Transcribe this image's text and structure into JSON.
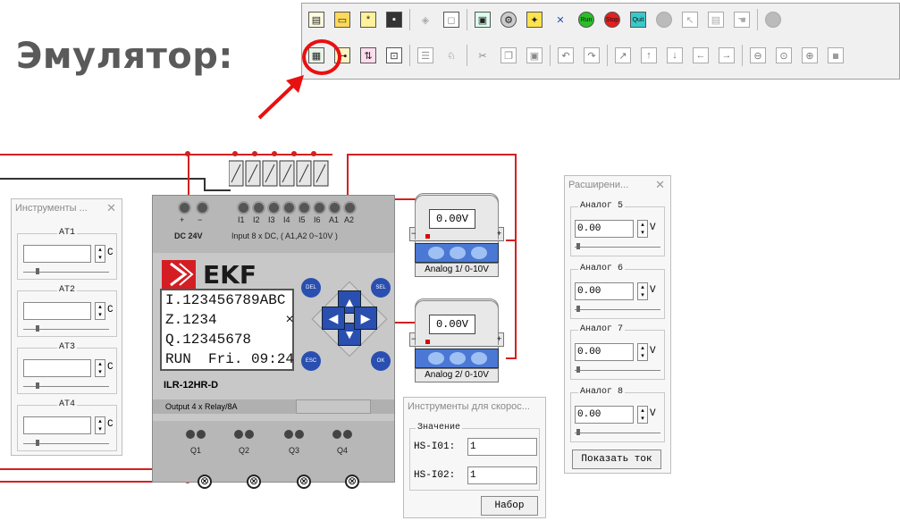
{
  "heading": "Эмулятор:",
  "toolbar": {
    "row1": [
      "new-icon",
      "open-icon",
      "plus-icon",
      "save-icon",
      "cube-icon",
      "preview-icon",
      "monitor-icon",
      "gear-icon",
      "chip-icon",
      "tools-icon",
      "run-icon",
      "stop-icon",
      "quit-icon",
      "disk-icon",
      "cursor-icon",
      "doc-icon",
      "hand-icon",
      "circle-icon"
    ],
    "row2": [
      "simulate-icon",
      "io-icon",
      "transfer-icon",
      "panel-icon",
      "list-icon",
      "find-icon",
      "cut-icon",
      "copy-icon",
      "paste-icon",
      "undo-icon",
      "redo-icon",
      "align-up-icon",
      "align-top-icon",
      "align-bottom-icon",
      "align-left-icon",
      "align-right-icon",
      "zoom-out-icon",
      "zoom-in-icon",
      "zoom-plus-icon",
      "grid-icon"
    ],
    "run_label": "Run",
    "stop_label": "Stop",
    "quit_label": "Quit"
  },
  "plc": {
    "power_label": "DC 24V",
    "input_label": "Input 8 x DC, ( A1,A2  0~10V )",
    "terminals_top": [
      "+",
      "−",
      "",
      "I1",
      "I2",
      "I3",
      "I4",
      "I5",
      "I6",
      "A1",
      "A2"
    ],
    "brand": "EKF",
    "lcd_lines": [
      "I.123456789ABC",
      "Z.1234        ×",
      "Q.12345678",
      "RUN  Fri. 09:24"
    ],
    "keys": {
      "del": "DEL",
      "sel": "SEL",
      "esc": "ESC",
      "ok": "OK"
    },
    "model": "ILR-12HR-D",
    "output_label": "Output 4 x Relay/8A",
    "relays": [
      "Q1",
      "Q2",
      "Q3",
      "Q4"
    ]
  },
  "analog_modules": [
    {
      "value": "0.00V",
      "label": "Analog 1/ 0-10V"
    },
    {
      "value": "0.00V",
      "label": "Analog 2/ 0-10V"
    }
  ],
  "tools_panel": {
    "title": "Инструменты ...",
    "groups": [
      {
        "label": "AT1",
        "value": "",
        "unit": "C"
      },
      {
        "label": "AT2",
        "value": "",
        "unit": "C"
      },
      {
        "label": "AT3",
        "value": "",
        "unit": "C"
      },
      {
        "label": "AT4",
        "value": "",
        "unit": "C"
      }
    ]
  },
  "ext_panel": {
    "title": "Расширени...",
    "groups": [
      {
        "label": "Аналог  5",
        "value": "0.00",
        "unit": "V"
      },
      {
        "label": "Аналог  6",
        "value": "0.00",
        "unit": "V"
      },
      {
        "label": "Аналог  7",
        "value": "0.00",
        "unit": "V"
      },
      {
        "label": "Аналог  8",
        "value": "0.00",
        "unit": "V"
      }
    ],
    "button": "Показать ток"
  },
  "speed_panel": {
    "title": "Инструменты для скорос...",
    "group_label": "Значение",
    "fields": [
      {
        "label": "HS-I01:",
        "value": "1"
      },
      {
        "label": "HS-I02:",
        "value": "1"
      }
    ],
    "button": "Набор"
  },
  "colors": {
    "wire": "#d42020",
    "key_blue": "#2a4fb0",
    "brand_red": "#d41e24",
    "highlight": "#e81010"
  }
}
